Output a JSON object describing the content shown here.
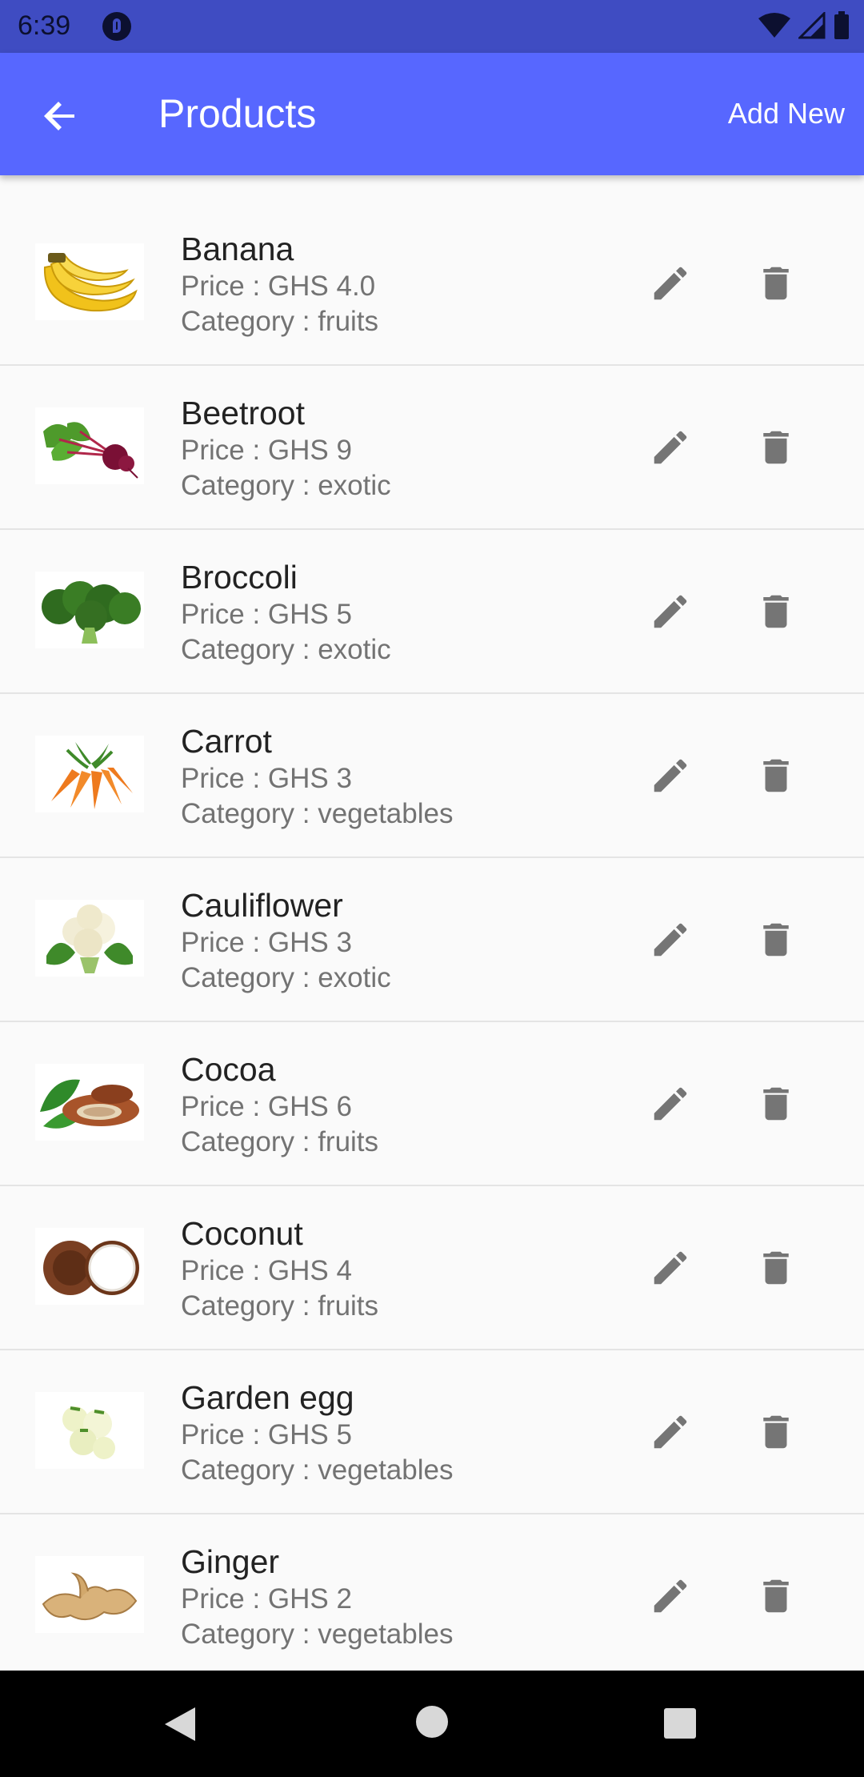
{
  "status_bar": {
    "time": "6:39",
    "icons": [
      "app-notification-icon",
      "wifi-icon",
      "cellular-signal-icon",
      "battery-icon"
    ]
  },
  "app_bar": {
    "title": "Products",
    "action_label": "Add New",
    "back_icon": "arrow-back-icon",
    "color": "#5767ff"
  },
  "products": [
    {
      "name": "Banana",
      "price": "Price : GHS 4.0",
      "category": "Category : fruits"
    },
    {
      "name": "Beetroot",
      "price": "Price : GHS 9",
      "category": "Category : exotic"
    },
    {
      "name": "Broccoli",
      "price": "Price : GHS 5",
      "category": "Category : exotic"
    },
    {
      "name": "Carrot",
      "price": "Price : GHS 3",
      "category": "Category : vegetables"
    },
    {
      "name": "Cauliflower",
      "price": "Price : GHS 3",
      "category": "Category : exotic"
    },
    {
      "name": "Cocoa",
      "price": "Price : GHS 6",
      "category": "Category : fruits"
    },
    {
      "name": "Coconut",
      "price": "Price : GHS 4",
      "category": "Category : fruits"
    },
    {
      "name": "Garden egg",
      "price": "Price : GHS 5",
      "category": "Category : vegetables"
    },
    {
      "name": "Ginger",
      "price": "Price : GHS 2",
      "category": "Category : vegetables"
    }
  ],
  "row_actions": {
    "edit_icon": "pencil-icon",
    "delete_icon": "trash-icon",
    "icon_color": "#757575"
  },
  "nav_bar": {
    "icons": [
      "nav-back-icon",
      "nav-home-icon",
      "nav-recents-icon"
    ]
  }
}
